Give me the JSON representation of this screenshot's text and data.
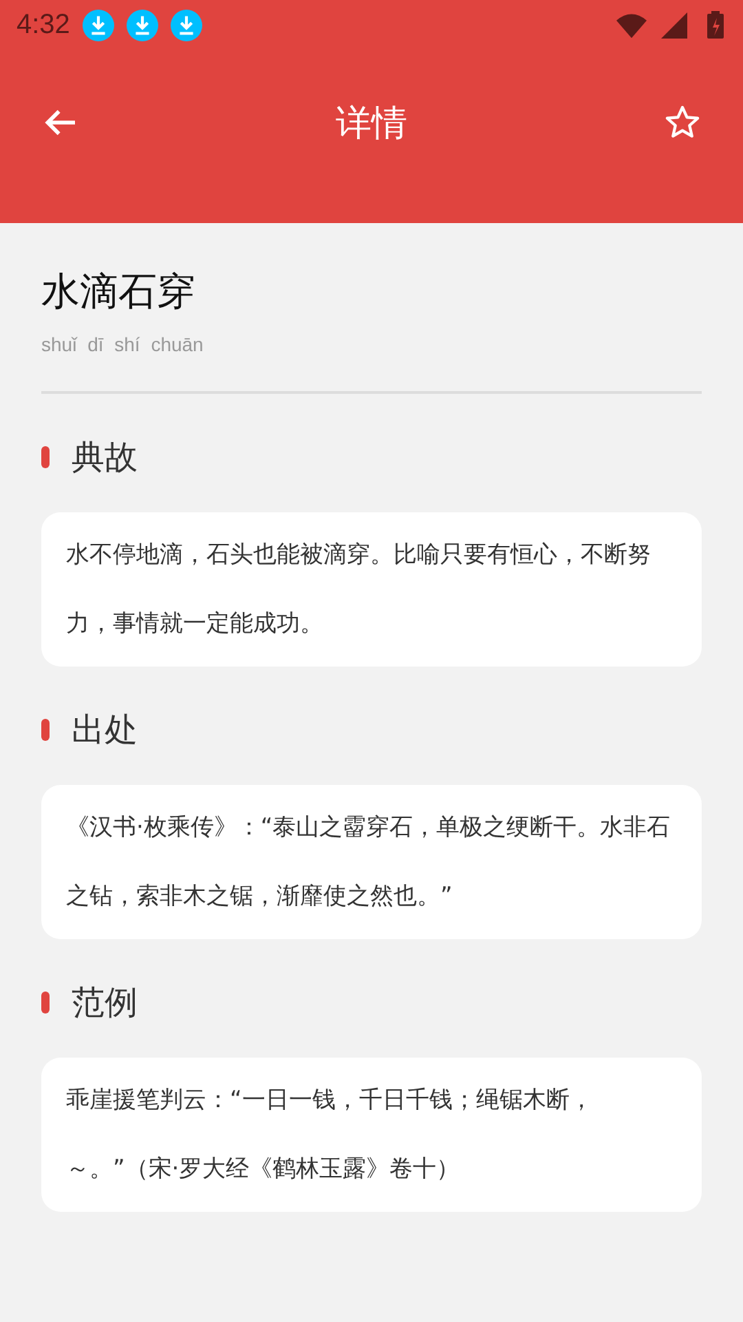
{
  "status_bar": {
    "time": "4:32",
    "notifications": [
      {
        "kind": "download"
      },
      {
        "kind": "download"
      },
      {
        "kind": "download"
      }
    ]
  },
  "header": {
    "title": "详情"
  },
  "idiom": {
    "title": "水滴石穿",
    "pinyin": "shuǐ dī shí chuān"
  },
  "sections": [
    {
      "heading": "典故",
      "text": "水不停地滴，石头也能被滴穿。比喻只要有恒心，不断努力，事情就一定能成功。"
    },
    {
      "heading": "出处",
      "text": "《汉书·枚乘传》：“泰山之霤穿石，单极之绠断干。水非石之钻，索非木之锯，渐靡使之然也。”"
    },
    {
      "heading": "范例",
      "text": "乖崖援笔判云：“一日一钱，千日千钱；绳锯木断，～。”（宋·罗大经《鹤林玉露》卷十）"
    }
  ]
}
